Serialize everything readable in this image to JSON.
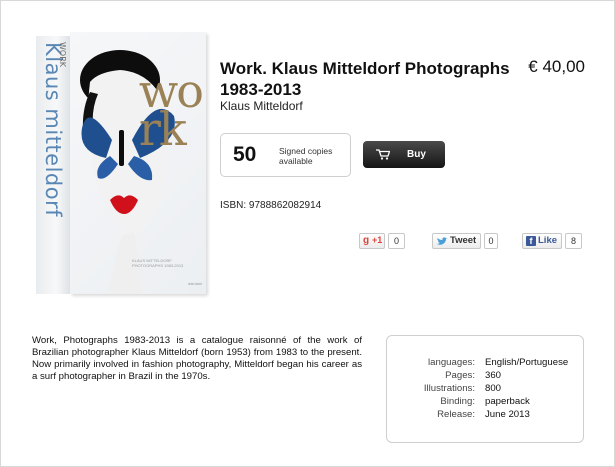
{
  "book": {
    "spine_title": "Klaus mitteldorf",
    "spine_work": "WORK",
    "cover_title": "wo\nrk",
    "cover_caption": "KLAUS MITTELDORF\nPHOTOGRAPHS 1983-2013",
    "cover_publisher": "damiani"
  },
  "product": {
    "title": "Work. Klaus Mitteldorf Photographs 1983-2013",
    "author": "Klaus Mitteldorf",
    "price": "€ 40,00",
    "signed_count": "50",
    "signed_label": "Signed copies available",
    "buy_label": "Buy",
    "isbn": "ISBN: 9788862082914"
  },
  "social": {
    "gplus_icon": "g",
    "gplus_label": "+1",
    "gplus_count": "0",
    "tweet_label": "Tweet",
    "tweet_count": "0",
    "facebook_icon": "f",
    "facebook_label": "Like",
    "facebook_count": "8"
  },
  "description": "Work, Photographs 1983-2013 is a catalogue raisonné of the work of Brazilian photographer Klaus Mitteldorf (born 1953) from 1983 to the present. Now primarily involved in fashion photography, Mitteldorf began his career as a surf photographer in Brazil in the 1970s.",
  "details": [
    {
      "label": "languages:",
      "value": "English/Portuguese"
    },
    {
      "label": "Pages:",
      "value": "360"
    },
    {
      "label": "Illustrations:",
      "value": "800"
    },
    {
      "label": "Binding:",
      "value": "paperback"
    },
    {
      "label": "Release:",
      "value": "June 2013"
    }
  ],
  "icons": {
    "cart": "cart-icon",
    "twitter": "bird-icon",
    "facebook": "facebook-icon",
    "googleplus": "google-plus-icon"
  },
  "colors": {
    "buy_button": "#151515",
    "spine_text": "#5a88b4",
    "cover_title": "#9a8256",
    "butterfly": "#1f4f8f",
    "lips": "#d0101a",
    "facebook": "#3b5998",
    "googleplus": "#d9453a"
  }
}
